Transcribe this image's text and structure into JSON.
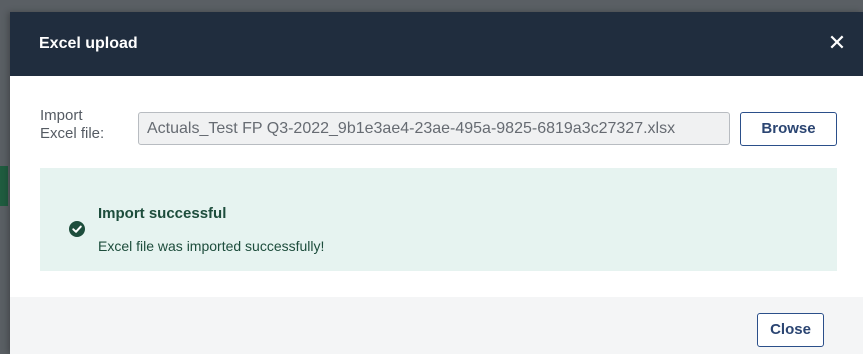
{
  "dialog": {
    "title": "Excel upload",
    "close_icon": "close-icon",
    "import_label": "Import Excel file:",
    "file_value": "Actuals_Test FP Q3-2022_9b1e3ae4-23ae-495a-9825-6819a3c27327.xlsx",
    "browse_label": "Browse",
    "alert": {
      "icon": "check-circle-icon",
      "title": "Import successful",
      "message": "Excel file was imported successfully!"
    },
    "close_label": "Close"
  },
  "colors": {
    "header_bg": "#202d3e",
    "alert_bg": "#e6f3f0",
    "alert_text": "#1d4d3c",
    "button_text": "#2b4572"
  }
}
